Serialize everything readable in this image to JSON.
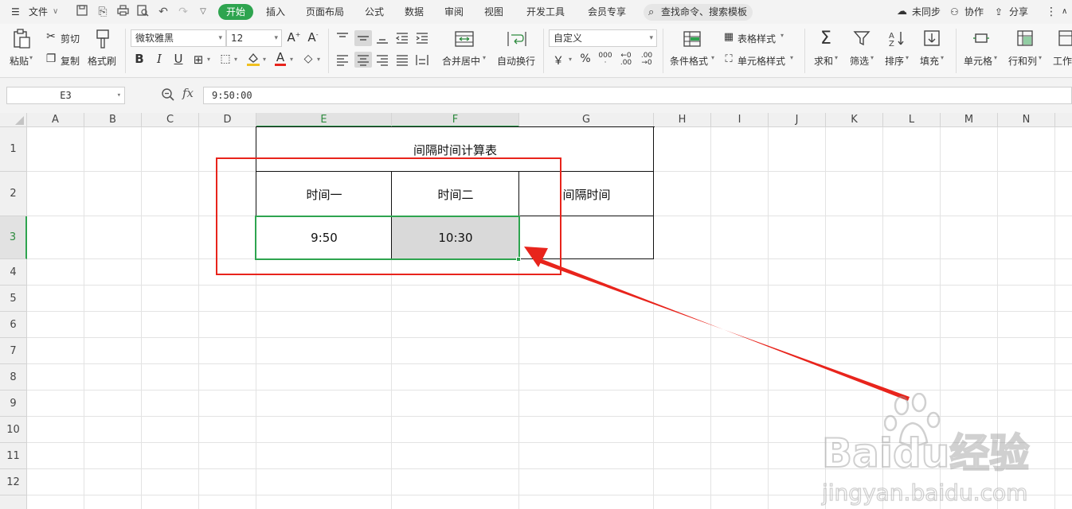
{
  "menubar": {
    "file": "文件",
    "tabs": [
      "开始",
      "插入",
      "页面布局",
      "公式",
      "数据",
      "审阅",
      "视图",
      "开发工具",
      "会员专享"
    ],
    "search": "查找命令、搜索模板",
    "sync": "未同步",
    "collab": "协作",
    "share": "分享"
  },
  "ribbon": {
    "paste": "粘贴",
    "cut": "剪切",
    "copy": "复制",
    "format_painter": "格式刷",
    "font_name": "微软雅黑",
    "font_size": "12",
    "merge_center": "合并居中",
    "wrap_text": "自动换行",
    "number_format": "自定义",
    "percent": "%",
    "table_style": "表格样式",
    "cell_style": "单元格样式",
    "cond_format": "条件格式",
    "sum": "求和",
    "filter": "筛选",
    "sort": "排序",
    "fill": "填充",
    "cell": "单元格",
    "row_col": "行和列",
    "worksheet": "工作"
  },
  "formula_bar": {
    "name_box": "E3",
    "fx": "fx",
    "formula": "9:50:00"
  },
  "sheet": {
    "columns": [
      "A",
      "B",
      "C",
      "D",
      "E",
      "F",
      "G",
      "H",
      "I",
      "J",
      "K",
      "L",
      "M",
      "N"
    ],
    "rows": [
      "1",
      "2",
      "3",
      "4",
      "5",
      "6",
      "7",
      "8",
      "9",
      "10",
      "11",
      "12"
    ],
    "title": "间隔时间计算表",
    "headers": [
      "时间一",
      "时间二",
      "间隔时间"
    ],
    "values": [
      "9:50",
      "10:30",
      ""
    ]
  },
  "watermark": {
    "brand": "Baidu经验",
    "url": "jingyan.baidu.com"
  },
  "colors": {
    "accent": "#2ea44f",
    "annotation": "#e8241c",
    "selected_fill": "#d9d9d9"
  }
}
